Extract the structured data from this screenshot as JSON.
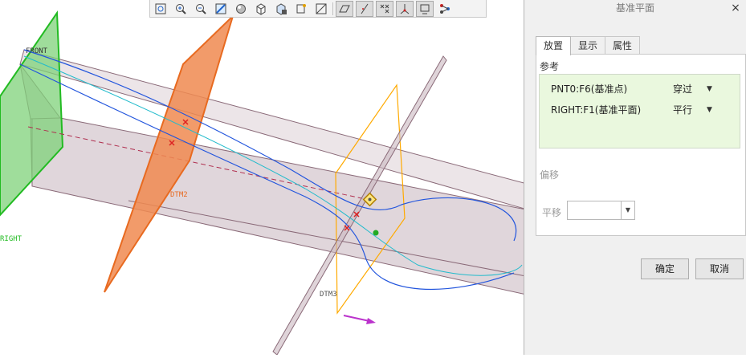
{
  "viewport": {
    "labels": {
      "front": "FRONT",
      "right": "RIGHT",
      "dtm2": "DTM2",
      "dtm3": "DTM3"
    },
    "colors": {
      "front_plane": "#7fd27a",
      "right_edge": "#22bb22",
      "dtm2_plane": "#f08a50",
      "dtm3_edge": "#ffaa00",
      "curve_blue": "#2255dd",
      "curve_cyan": "#22bbcc",
      "box_face": "#d9ccd2",
      "selection_red": "#dd2222",
      "arrow_magenta": "#bb33cc"
    }
  },
  "toolbar": {
    "buttons": [
      {
        "icon": "refit-icon"
      },
      {
        "icon": "zoom-in-icon"
      },
      {
        "icon": "zoom-out-icon"
      },
      {
        "icon": "repaint-icon"
      },
      {
        "icon": "shading-icon"
      },
      {
        "icon": "saved-views-icon"
      },
      {
        "icon": "section-icon"
      },
      {
        "icon": "display-style-icon"
      },
      {
        "icon": "spin-center-icon"
      },
      {
        "icon": "annotation-display-icon"
      },
      {
        "icon": "plane-display-icon"
      },
      {
        "icon": "axis-display-icon"
      },
      {
        "icon": "point-display-icon"
      },
      {
        "icon": "csys-display-icon"
      },
      {
        "icon": "model-tree-icon"
      },
      {
        "icon": "connection-icon"
      }
    ]
  },
  "dialog": {
    "title": "基准平面",
    "close": "×",
    "tabs": [
      "放置",
      "显示",
      "属性"
    ],
    "references_label": "参考",
    "references": [
      {
        "name": "PNT0:F6(基准点)",
        "type": "穿过"
      },
      {
        "name": "RIGHT:F1(基准平面)",
        "type": "平行"
      }
    ],
    "offset_label": "偏移",
    "shift_label": "平移",
    "shift_value": "",
    "ok": "确定",
    "cancel": "取消"
  }
}
